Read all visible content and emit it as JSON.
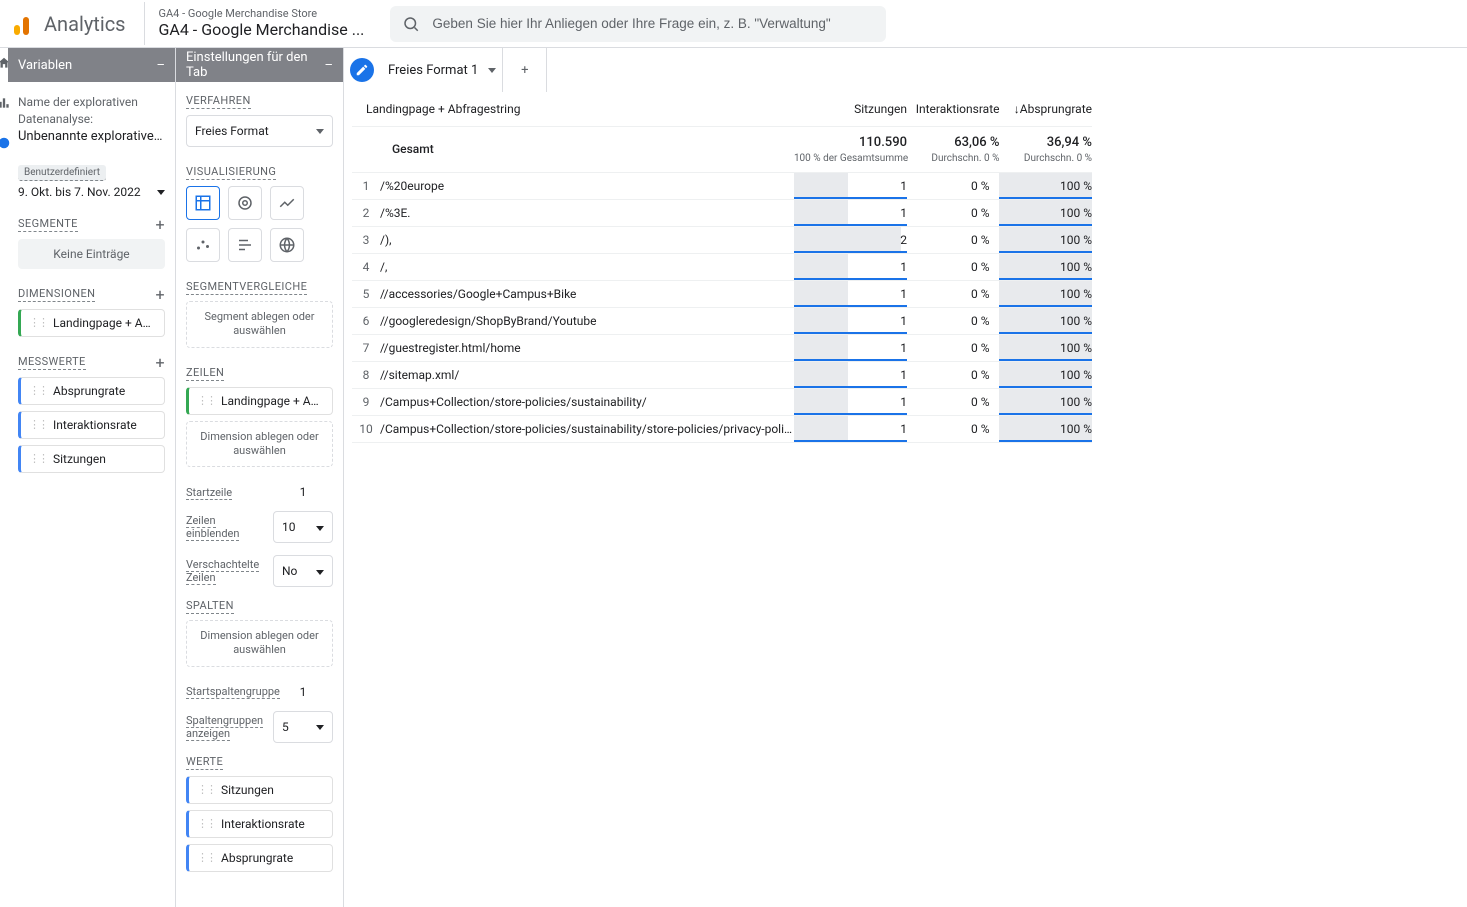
{
  "top": {
    "product": "Analytics",
    "property_small": "GA4 - Google Merchandise Store",
    "property_large": "GA4 - Google Merchandise ...",
    "search_placeholder": "Geben Sie hier Ihr Anliegen oder Ihre Frage ein, z. B. \"Verwaltung\""
  },
  "variables_panel": {
    "title": "Variablen",
    "name_label": "Name der explorativen Datenanalyse:",
    "name_value": "Unbenannte explorative Da...",
    "date_custom": "Benutzerdefiniert",
    "date_range": "9. Okt. bis 7. Nov. 2022",
    "segments_label": "SEGMENTE",
    "no_entries": "Keine Einträge",
    "dimensions_label": "DIMENSIONEN",
    "dim_chip": "Landingpage + Abfr...",
    "metrics_label": "MESSWERTE",
    "metric_chips": [
      "Absprungrate",
      "Interaktionsrate",
      "Sitzungen"
    ]
  },
  "settings_panel": {
    "title": "Einstellungen für den Tab",
    "verfahren_label": "VERFAHREN",
    "verfahren_value": "Freies Format",
    "viz_label": "VISUALISIERUNG",
    "segcomp_label": "SEGMENTVERGLEICHE",
    "segcomp_drop": "Segment ablegen oder auswählen",
    "rows_label": "ZEILEN",
    "rows_chip": "Landingpage + Abfr...",
    "rows_drop": "Dimension ablegen oder auswählen",
    "startrow_label": "Startzeile",
    "startrow_value": "1",
    "showrows_label": "Zeilen einblenden",
    "showrows_value": "10",
    "nested_label": "Verschachtelte Zeilen",
    "nested_value": "No",
    "cols_label": "SPALTEN",
    "cols_drop": "Dimension ablegen oder auswählen",
    "startcolg_label": "Startspaltengruppe",
    "startcolg_value": "1",
    "colg_show_label": "Spaltengruppen anzeigen",
    "colg_show_value": "5",
    "values_label": "WERTE",
    "value_chips": [
      "Sitzungen",
      "Interaktionsrate",
      "Absprungrate"
    ]
  },
  "explore": {
    "tab_name": "Freies Format 1",
    "headers": {
      "dim": "Landingpage + Abfragestring",
      "c1": "Sitzungen",
      "c2": "Interaktionsrate",
      "c3": "Absprungrate"
    },
    "summary": {
      "label": "Gesamt",
      "c1_big": "110.590",
      "c1_sub": "100 % der Gesamtsumme",
      "c2_big": "63,06 %",
      "c2_sub": "Durchschn. 0 %",
      "c3_big": "36,94 %",
      "c3_sub": "Durchschn. 0 %"
    },
    "rows": [
      {
        "i": "1",
        "dim": "/%20europe",
        "sess": "1",
        "inter": "0 %",
        "bounce": "100 %",
        "bar": 48
      },
      {
        "i": "2",
        "dim": "/%3E.",
        "sess": "1",
        "inter": "0 %",
        "bounce": "100 %",
        "bar": 48
      },
      {
        "i": "3",
        "dim": "/),",
        "sess": "2",
        "inter": "0 %",
        "bounce": "100 %",
        "bar": 95
      },
      {
        "i": "4",
        "dim": "/,",
        "sess": "1",
        "inter": "0 %",
        "bounce": "100 %",
        "bar": 48
      },
      {
        "i": "5",
        "dim": "//accessories/Google+Campus+Bike",
        "sess": "1",
        "inter": "0 %",
        "bounce": "100 %",
        "bar": 48
      },
      {
        "i": "6",
        "dim": "//googleredesign/ShopByBrand/Youtube",
        "sess": "1",
        "inter": "0 %",
        "bounce": "100 %",
        "bar": 48
      },
      {
        "i": "7",
        "dim": "//guestregister.html/home",
        "sess": "1",
        "inter": "0 %",
        "bounce": "100 %",
        "bar": 48
      },
      {
        "i": "8",
        "dim": "//sitemap.xml/",
        "sess": "1",
        "inter": "0 %",
        "bounce": "100 %",
        "bar": 48
      },
      {
        "i": "9",
        "dim": "/Campus+Collection/store-policies/sustainability/",
        "sess": "1",
        "inter": "0 %",
        "bounce": "100 %",
        "bar": 48
      },
      {
        "i": "10",
        "dim": "/Campus+Collection/store-policies/sustainability/store-policies/privacy-policy/",
        "sess": "1",
        "inter": "0 %",
        "bounce": "100 %",
        "bar": 48
      }
    ]
  }
}
